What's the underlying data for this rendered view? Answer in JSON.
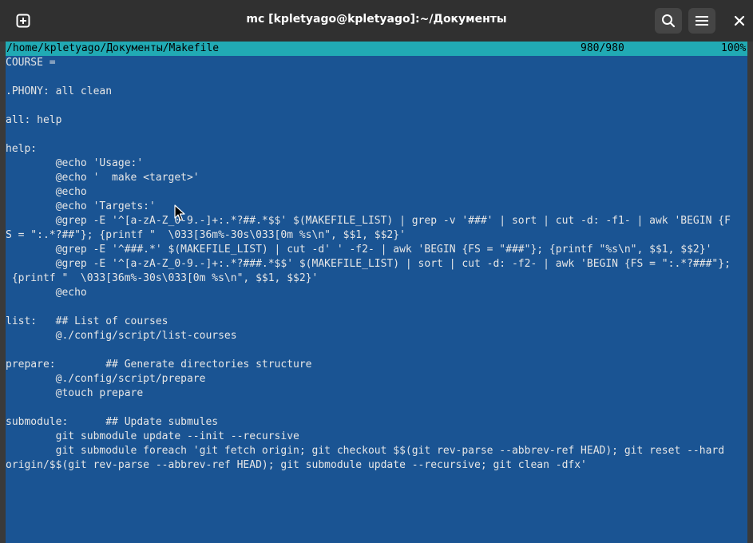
{
  "window": {
    "title": "mc [kpletyago@kpletyago]:~/Документы"
  },
  "titlebar": {
    "new_tab_icon": "plus-square-icon",
    "search_icon": "search-icon",
    "menu_icon": "hamburger-menu-icon",
    "close_icon": "close-icon",
    "new_tab_glyph": "⊞",
    "close_glyph": "×"
  },
  "editor": {
    "file_path": "/home/kpletyago/Документы/Makefile",
    "position": "980/980",
    "percent": "100%",
    "colors": {
      "background": "#1a5493",
      "status_bar": "#21aab4",
      "text": "#e6e6e6"
    },
    "lines": [
      "COURSE =",
      "",
      ".PHONY: all clean",
      "",
      "all: help",
      "",
      "help:",
      "        @echo 'Usage:'",
      "        @echo '  make <target>'",
      "        @echo",
      "        @echo 'Targets:'",
      "        @grep -E '^[a-zA-Z_0-9.-]+:.*?##.*$$' $(MAKEFILE_LIST) | grep -v '###' | sort | cut -d: -f1- | awk 'BEGIN {F",
      "S = \":.*?##\"}; {printf \"  \\033[36m%-30s\\033[0m %s\\n\", $$1, $$2}'",
      "        @grep -E '^###.*' $(MAKEFILE_LIST) | cut -d' ' -f2- | awk 'BEGIN {FS = \"###\"}; {printf \"%s\\n\", $$1, $$2}'",
      "        @grep -E '^[a-zA-Z_0-9.-]+:.*?###.*$$' $(MAKEFILE_LIST) | sort | cut -d: -f2- | awk 'BEGIN {FS = \":.*?###\"};",
      " {printf \"  \\033[36m%-30s\\033[0m %s\\n\", $$1, $$2}'",
      "        @echo",
      "",
      "list:   ## List of courses",
      "        @./config/script/list-courses",
      "",
      "prepare:        ## Generate directories structure",
      "        @./config/script/prepare",
      "        @touch prepare",
      "",
      "submodule:      ## Update submules",
      "        git submodule update --init --recursive",
      "        git submodule foreach 'git fetch origin; git checkout $$(git rev-parse --abbrev-ref HEAD); git reset --hard",
      "origin/$$(git rev-parse --abbrev-ref HEAD); git submodule update --recursive; git clean -dfx'"
    ]
  }
}
